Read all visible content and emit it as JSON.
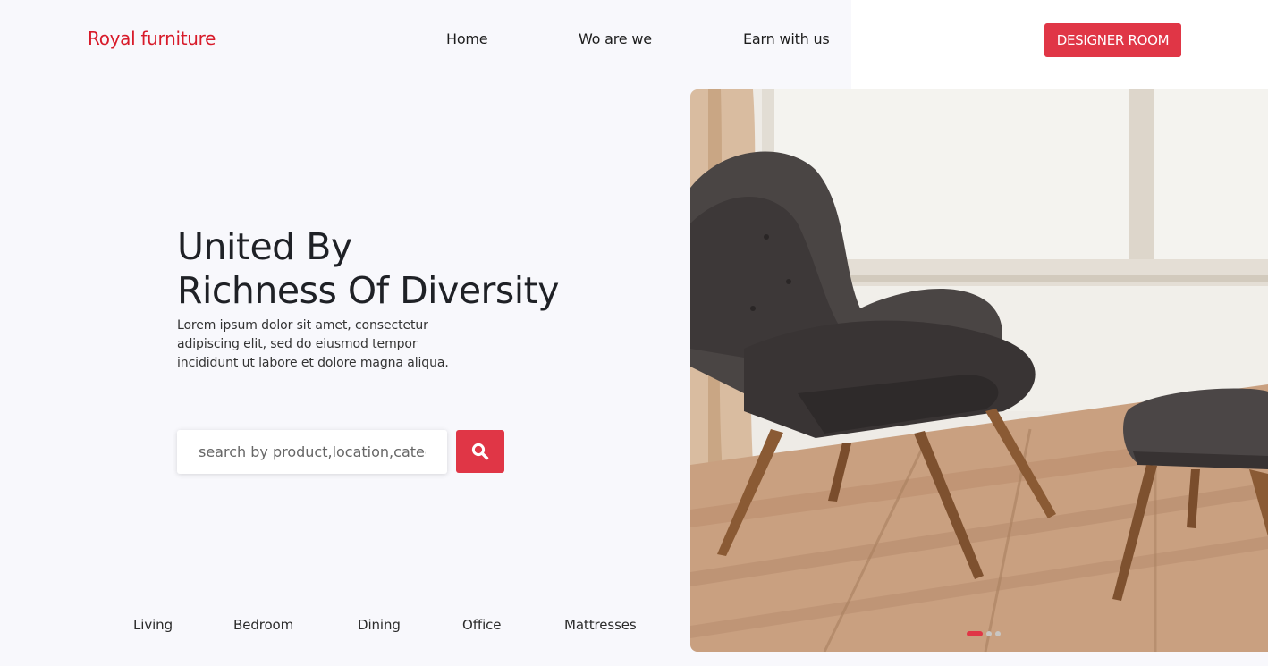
{
  "brand": {
    "logo": "Royal furniture",
    "accent_color": "#e03646",
    "logo_color": "#d81b2a"
  },
  "nav": {
    "items": [
      {
        "label": "Home"
      },
      {
        "label": "Wo are we"
      },
      {
        "label": "Earn with us"
      }
    ],
    "cta_label": "DESIGNER ROOM"
  },
  "hero": {
    "title_line1": "United By",
    "title_line2": "Richness Of Diversity",
    "description": "Lorem ipsum dolor sit amet, consectetur adipiscing elit, sed do eiusmod tempor incididunt ut labore et dolore magna aliqua.",
    "image_icon": "armchair-photo"
  },
  "search": {
    "placeholder": "search by product,location,category",
    "value": "",
    "button_icon": "search-icon"
  },
  "categories": [
    {
      "label": "Living"
    },
    {
      "label": "Bedroom"
    },
    {
      "label": "Dining"
    },
    {
      "label": "Office"
    },
    {
      "label": "Mattresses"
    }
  ],
  "carousel": {
    "slides": 3,
    "active_slide": 1
  }
}
